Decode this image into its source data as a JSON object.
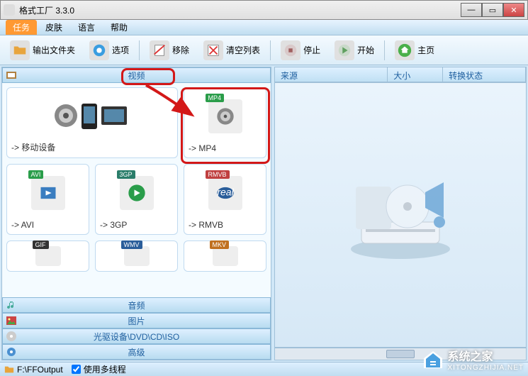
{
  "window": {
    "title": "格式工厂 3.3.0",
    "controls": {
      "min": "—",
      "max": "▭",
      "close": "✕"
    }
  },
  "menu": {
    "task": "任务",
    "skin": "皮肤",
    "language": "语言",
    "help": "帮助"
  },
  "toolbar": {
    "output_folder": "输出文件夹",
    "options": "选项",
    "remove": "移除",
    "clear": "清空列表",
    "stop": "停止",
    "start": "开始",
    "home": "主页"
  },
  "sections": {
    "video": "视频",
    "audio": "音频",
    "picture": "图片",
    "disc": "光驱设备\\DVD\\CD\\ISO",
    "advanced": "高级"
  },
  "formats": {
    "mobile": "-> 移动设备",
    "mp4": "-> MP4",
    "avi": "-> AVI",
    "3gp": "-> 3GP",
    "rmvb": "-> RMVB",
    "gif": "GIF",
    "wmv": "WMV",
    "mkv": "MKV",
    "tag_mp4": "MP4",
    "tag_avi": "AVI",
    "tag_3gp": "3GP",
    "tag_rmvb": "RMVB",
    "tag_gif": "GIF",
    "tag_wmv": "WMV",
    "tag_mkv": "MKV"
  },
  "list": {
    "col_source": "来源",
    "col_size": "大小",
    "col_status": "转换状态"
  },
  "status": {
    "output_path": "F:\\FFOutput",
    "multithread": "使用多线程"
  },
  "watermark": {
    "name": "系统之家",
    "url": "XITONGZHIJIA.NET"
  }
}
